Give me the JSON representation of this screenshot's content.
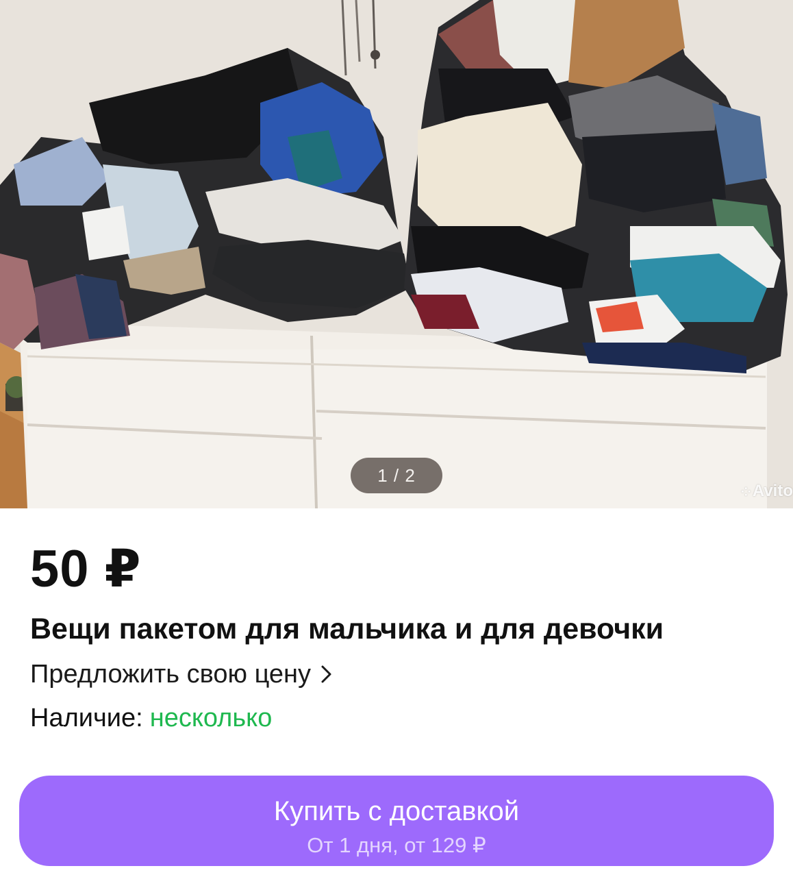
{
  "gallery": {
    "counter": "1 / 2",
    "watermark": "Avito",
    "image_alt": "photo-clothes-on-dresser"
  },
  "listing": {
    "price": "50 ₽",
    "title": "Вещи пакетом для мальчика и для девочки",
    "offer_price_label": "Предложить свою цену",
    "availability_label": "Наличие:",
    "availability_value": "несколько"
  },
  "buy_button": {
    "label": "Купить с доставкой",
    "subtitle": "От 1 дня, от 129 ₽"
  },
  "colors": {
    "accent_purple": "#9d6afc",
    "availability_green": "#1fb84f"
  }
}
